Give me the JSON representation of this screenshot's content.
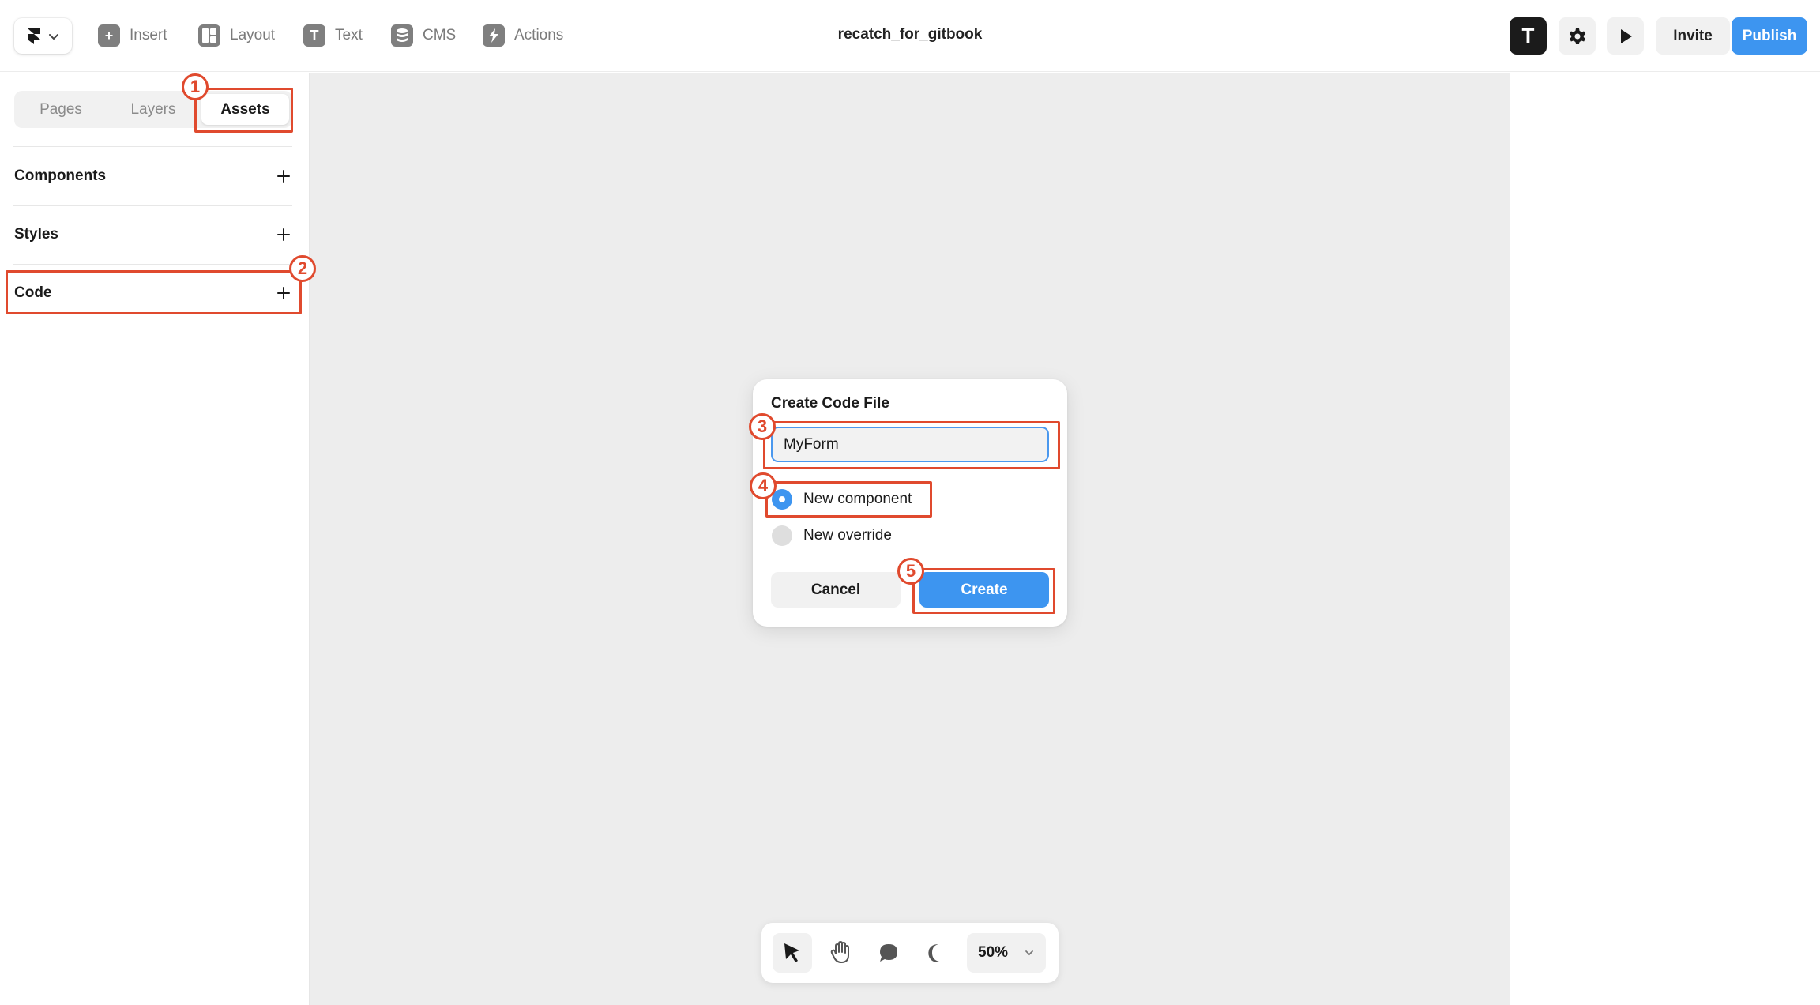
{
  "toolbar": {
    "items": [
      {
        "label": "Insert",
        "icon": "plus-square-icon",
        "glyph": "+"
      },
      {
        "label": "Layout",
        "icon": "layout-icon",
        "glyph": ""
      },
      {
        "label": "Text",
        "icon": "text-icon",
        "glyph": "T"
      },
      {
        "label": "CMS",
        "icon": "database-icon",
        "glyph": ""
      },
      {
        "label": "Actions",
        "icon": "lightning-icon",
        "glyph": ""
      }
    ],
    "project_name": "recatch_for_gitbook",
    "avatar_glyph": "T",
    "invite_label": "Invite",
    "publish_label": "Publish",
    "accent_color": "#3d95f0"
  },
  "left_panel": {
    "tabs": [
      {
        "label": "Pages",
        "active": false
      },
      {
        "label": "Layers",
        "active": false
      },
      {
        "label": "Assets",
        "active": true
      }
    ],
    "sections": [
      {
        "label": "Components"
      },
      {
        "label": "Styles"
      },
      {
        "label": "Code"
      }
    ]
  },
  "dialog": {
    "title": "Create Code File",
    "name_value": "MyForm",
    "options": [
      {
        "label": "New component",
        "checked": true
      },
      {
        "label": "New override",
        "checked": false
      }
    ],
    "cancel_label": "Cancel",
    "create_label": "Create"
  },
  "bottom_toolbar": {
    "tools": [
      "select-cursor-icon",
      "hand-icon",
      "comment-icon",
      "dark-mode-moon-icon"
    ],
    "zoom": "50%"
  },
  "annotations": {
    "color": "#e04a2e",
    "steps": [
      "1",
      "2",
      "3",
      "4",
      "5"
    ]
  }
}
